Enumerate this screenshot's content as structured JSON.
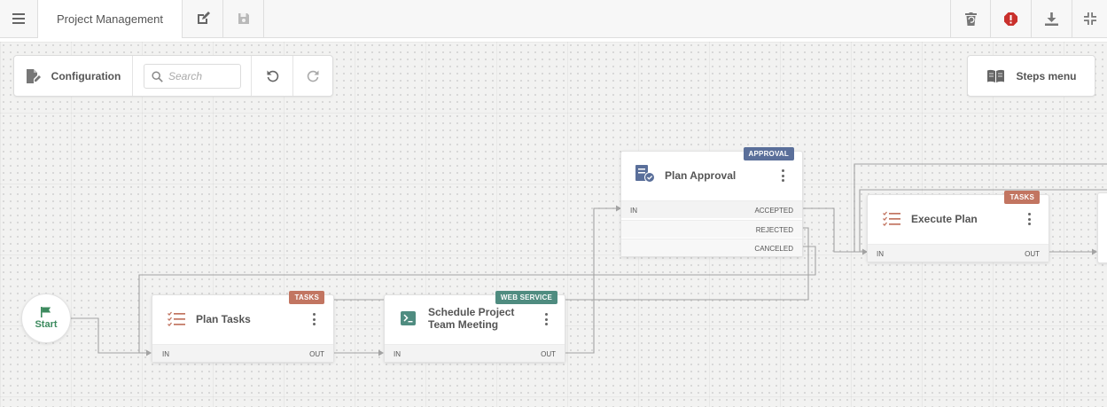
{
  "header": {
    "menu_icon": "hamburger-icon",
    "title": "Project Management",
    "edit_icon": "edit-icon",
    "save_icon": "save-icon",
    "right_icons": [
      "delete-icon",
      "error-icon",
      "download-icon",
      "collapse-icon"
    ]
  },
  "toolbar": {
    "config_label": "Configuration",
    "search_placeholder": "Search",
    "undo_icon": "undo-icon",
    "redo_icon": "redo-icon",
    "steps_label": "Steps menu"
  },
  "start": {
    "label": "Start"
  },
  "nodes": {
    "plan_tasks": {
      "title": "Plan Tasks",
      "badge": "TASKS",
      "in": "IN",
      "out": "OUT"
    },
    "meeting": {
      "title_line1": "Schedule Project",
      "title_line2": "Team Meeting",
      "badge": "WEB SERVICE",
      "in": "IN",
      "out": "OUT"
    },
    "approval": {
      "title": "Plan Approval",
      "badge": "APPROVAL",
      "in": "IN",
      "accepted": "ACCEPTED",
      "rejected": "REJECTED",
      "canceled": "CANCELED"
    },
    "execute": {
      "title": "Execute Plan",
      "badge": "TASKS",
      "in": "IN",
      "out": "OUT"
    }
  },
  "colors": {
    "tasks_badge": "#c27561",
    "web_service_badge": "#4f8c80",
    "approval_badge": "#5a6f9a",
    "start_green": "#3c8a5e",
    "error_red": "#c9302c",
    "wire": "#a3a3a3"
  }
}
